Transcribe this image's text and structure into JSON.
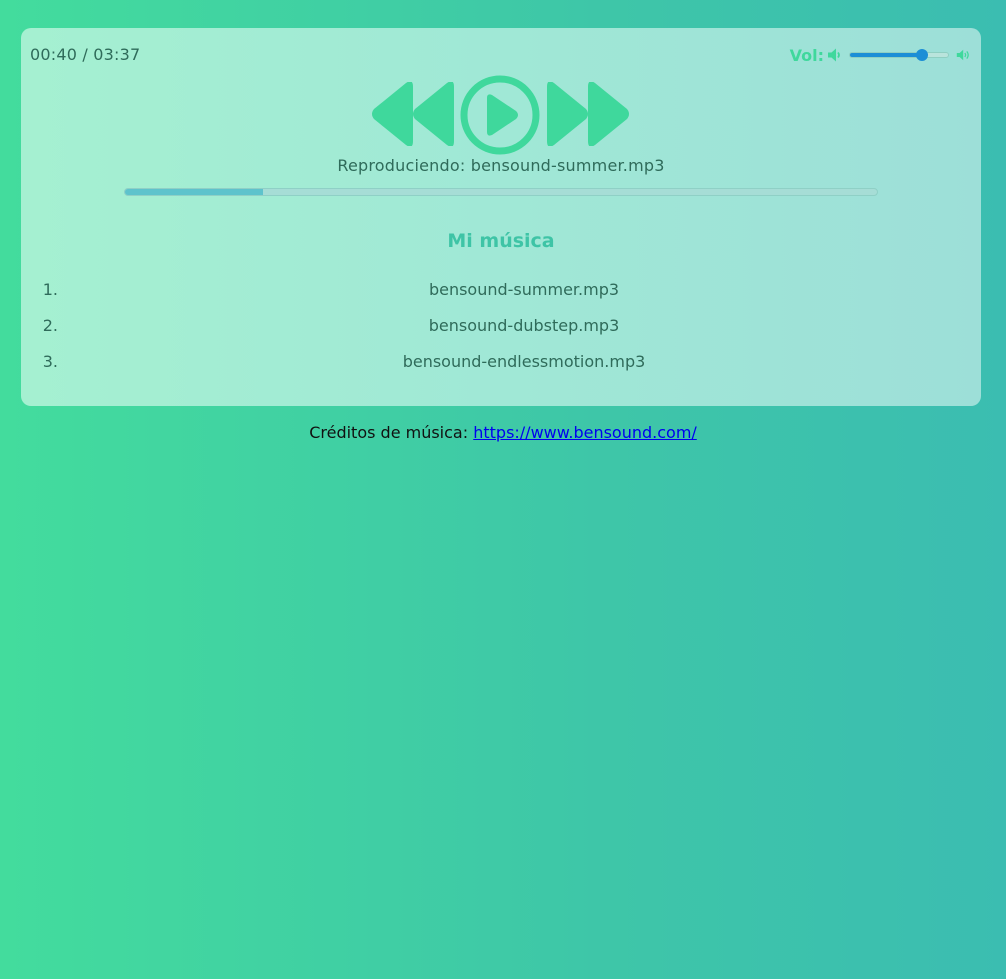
{
  "player": {
    "time": "00:40 / 03:37",
    "volume": {
      "label": "Vol:",
      "level": 0.73,
      "color": "#1c8ed6"
    },
    "controls": {
      "rewind_icon": "rewind-icon",
      "play_icon": "play-icon",
      "fast_forward_icon": "fast-forward-icon",
      "color": "#3fd89c"
    },
    "now_playing": "Reproduciendo: bensound-summer.mp3",
    "progress": 0.183
  },
  "playlist": {
    "title": "Mi música",
    "items": [
      {
        "num": "1.",
        "name": "bensound-summer.mp3"
      },
      {
        "num": "2.",
        "name": "bensound-dubstep.mp3"
      },
      {
        "num": "3.",
        "name": "bensound-endlessmotion.mp3"
      }
    ]
  },
  "credits": {
    "label": "Créditos de música:",
    "link_text": "https://www.bensound.com/"
  },
  "colors": {
    "accent": "#3fd89c",
    "playlist_title": "#3ec4a6",
    "text": "#2f6b5a"
  }
}
